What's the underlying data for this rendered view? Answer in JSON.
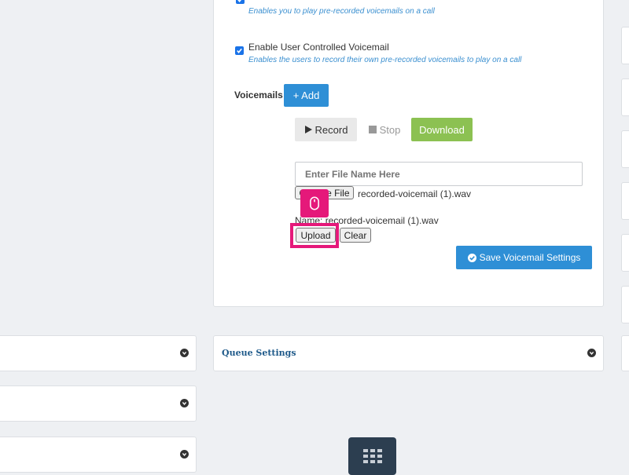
{
  "voicemail": {
    "option1_help": "Enables you to play pre-recorded voicemails on a call",
    "option2_label": "Enable User Controlled Voicemail",
    "option2_help": "Enables the users to record their own pre-recorded voicemails to play on a call",
    "section_label": "Voicemails",
    "add_label": "+ Add",
    "record_label": "Record",
    "stop_label": "Stop",
    "download_label": "Download",
    "file_name_placeholder": "Enter File Name Here",
    "choose_file_label": "Choose File",
    "chosen_file_name": "recorded-voicemail (1).wav",
    "name_prefix": "Name:",
    "name_value": "recorded-voicemail (1).wav",
    "upload_label": "Upload",
    "clear_label": "Clear",
    "save_label": "Save Voicemail Settings"
  },
  "queue_settings": {
    "title": "Queue Settings"
  },
  "colors": {
    "primary": "#2e8fd6",
    "success": "#8cc152",
    "highlight": "#e5197a",
    "link": "#1f5a8a"
  },
  "icons": [
    "check-icon",
    "play-icon",
    "stop-square-icon",
    "check-circle-icon",
    "chevron-circle-down-icon",
    "mouse-icon",
    "grid-icon"
  ]
}
